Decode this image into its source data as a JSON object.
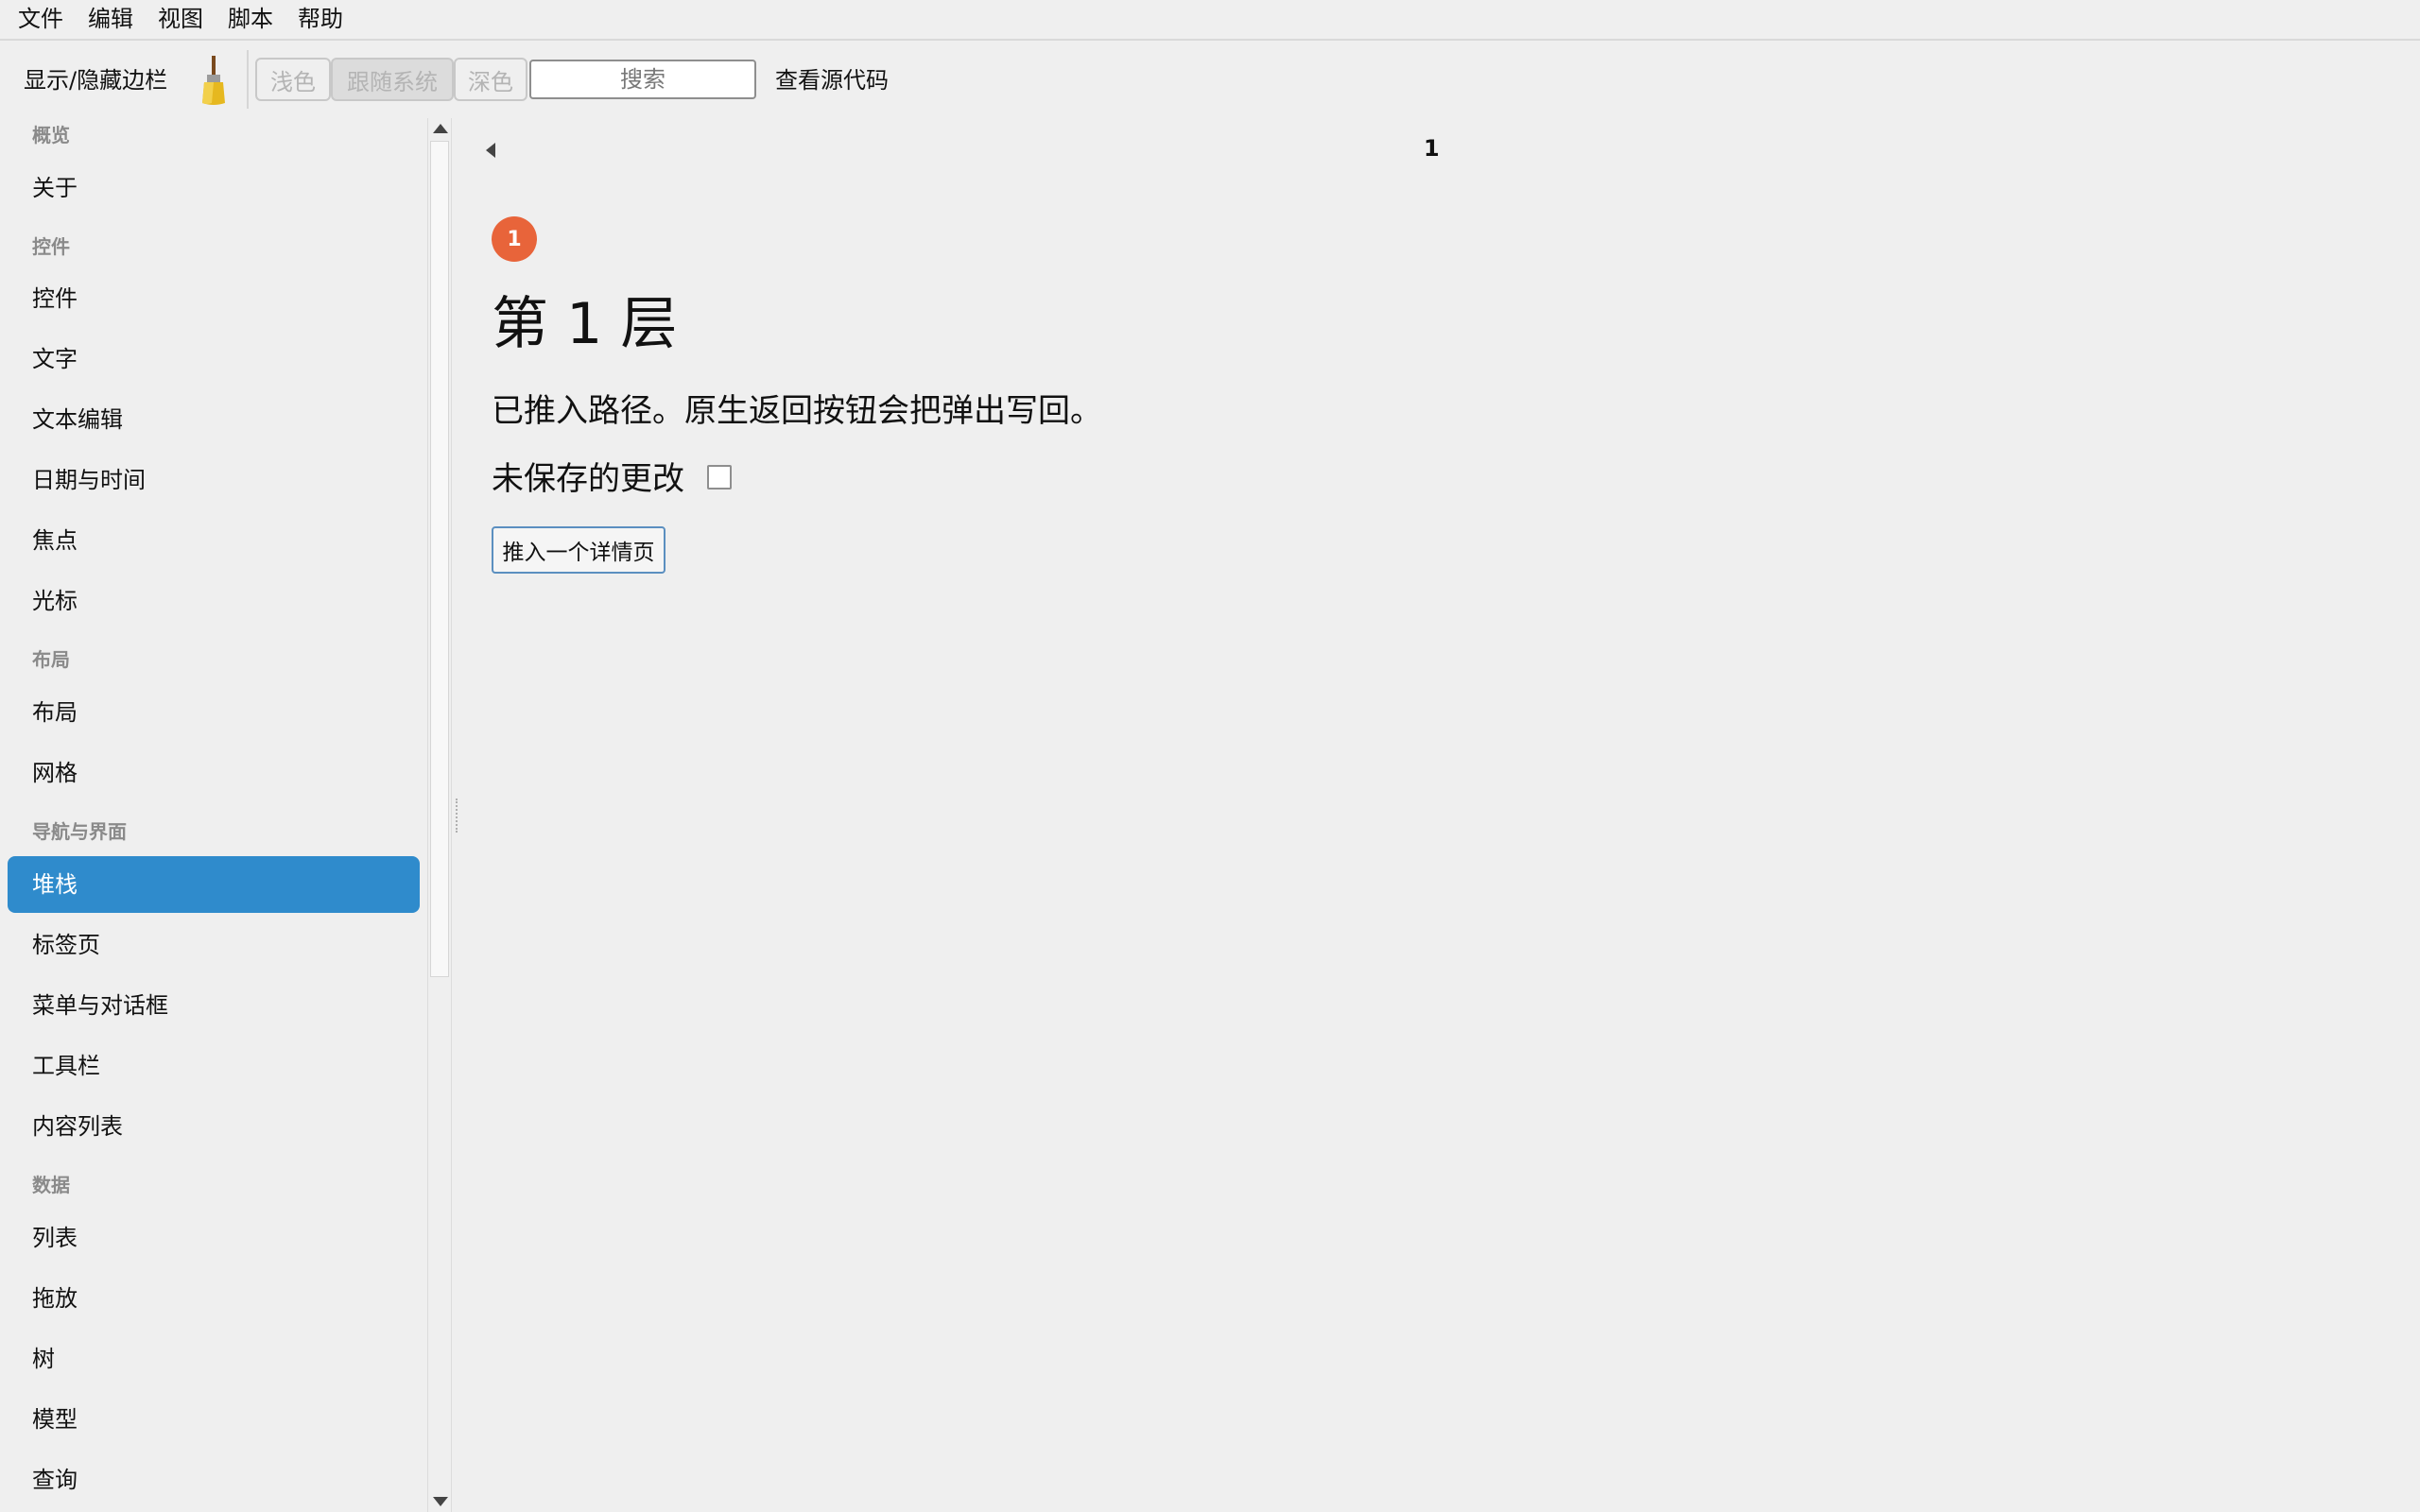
{
  "menu": [
    "文件",
    "编辑",
    "视图",
    "脚本",
    "帮助"
  ],
  "toolbar": {
    "toggle_sidebar": "显示/隐藏边栏",
    "theme_light": "浅色",
    "theme_system": "跟随系统",
    "theme_dark": "深色",
    "search_placeholder": "搜索",
    "view_source": "查看源代码"
  },
  "sidebar": {
    "headers": [
      "概览",
      "控件",
      "布局",
      "导航与界面",
      "数据"
    ],
    "items": [
      "关于",
      "控件",
      "文字",
      "文本编辑",
      "日期与时间",
      "焦点",
      "光标",
      "布局",
      "网格",
      "堆栈",
      "标签页",
      "菜单与对话框",
      "工具栏",
      "内容列表",
      "列表",
      "拖放",
      "树",
      "模型",
      "查询"
    ],
    "selected": "堆栈"
  },
  "main": {
    "page_number": "1",
    "badge": "1",
    "title": "第 1 层",
    "description": "已推入路径。原生返回按钮会把弹出写回。",
    "unsaved_label": "未保存的更改",
    "unsaved_checked": false,
    "push_button": "推入一个详情页"
  },
  "colors": {
    "selected_bg": "#2f8bcc",
    "badge_bg": "#e8643a"
  }
}
